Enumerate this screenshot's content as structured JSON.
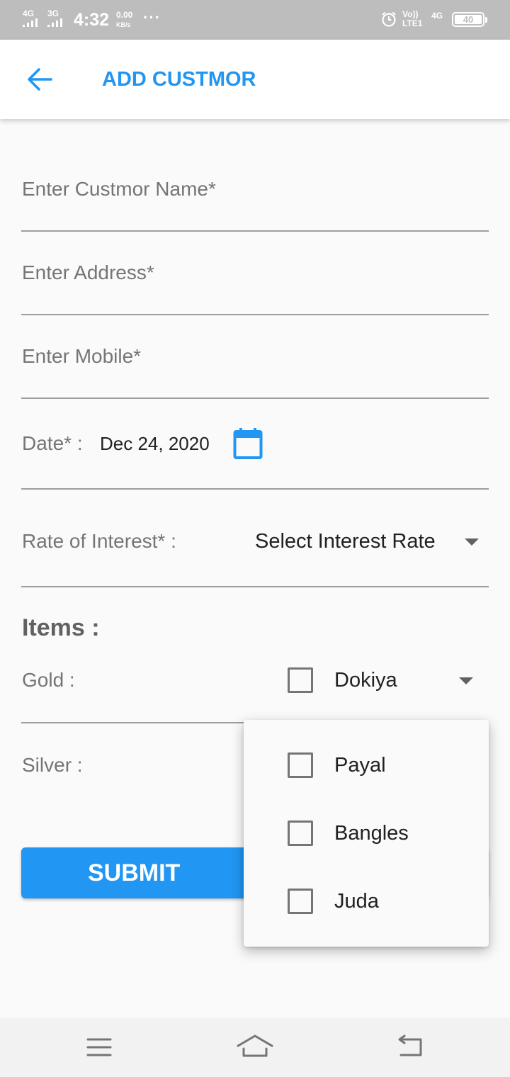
{
  "status_bar": {
    "network1": "4G",
    "network2": "3G",
    "time": "4:32",
    "speed_value": "0.00",
    "speed_unit": "KB/s",
    "more": "···",
    "volte_top": "Vo))",
    "volte_bottom": "LTE1",
    "network3": "4G",
    "battery": "40",
    "icons": [
      "signal-icon",
      "alarm-icon",
      "battery-icon"
    ]
  },
  "app_bar": {
    "back_icon": "arrow-left-icon",
    "title": "ADD CUSTMOR"
  },
  "form": {
    "name_placeholder": "Enter Custmor Name*",
    "address_placeholder": "Enter Address*",
    "mobile_placeholder": "Enter Mobile*",
    "date_label": "Date* :",
    "date_value": "Dec 24, 2020",
    "calendar_icon": "calendar-icon",
    "rate_label": "Rate of Interest* :",
    "rate_dropdown_value": "Select Interest Rate"
  },
  "items": {
    "heading": "Items :",
    "gold_label": "Gold :",
    "gold_selected_option": "Dokiya",
    "silver_label": "Silver :"
  },
  "dropdown_menu": {
    "options": [
      {
        "label": "Payal",
        "checked": false
      },
      {
        "label": "Bangles",
        "checked": false
      },
      {
        "label": "Juda",
        "checked": false
      }
    ]
  },
  "submit": {
    "label": "SUBMIT"
  },
  "nav_bar": {
    "icons": [
      "menu-icon",
      "home-icon",
      "back-icon"
    ]
  },
  "colors": {
    "accent": "#2196f3",
    "status_bar": "#bdbdbd",
    "label_text": "#757575",
    "divider": "#9e9e9e"
  }
}
